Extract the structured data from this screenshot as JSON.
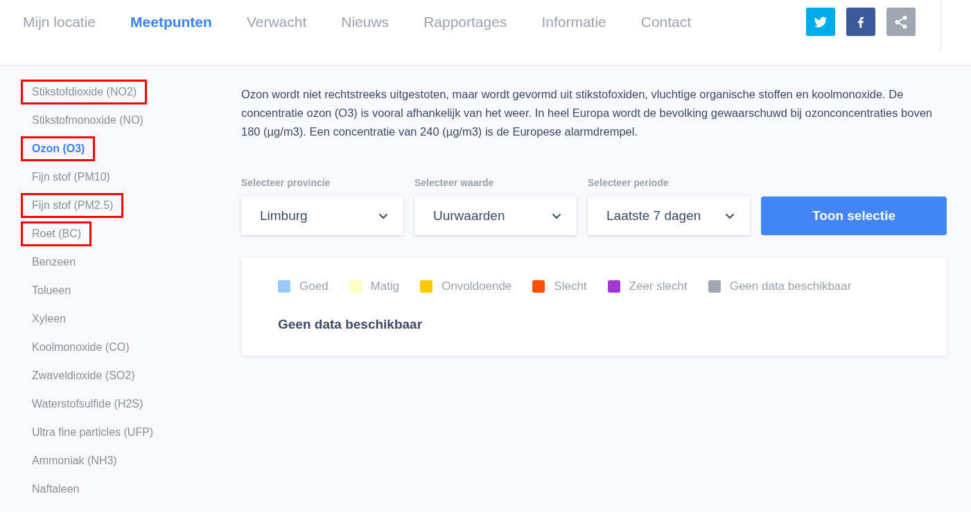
{
  "nav": [
    {
      "label": "Mijn locatie",
      "selected": false
    },
    {
      "label": "Meetpunten",
      "selected": true
    },
    {
      "label": "Verwacht",
      "selected": false
    },
    {
      "label": "Nieuws",
      "selected": false
    },
    {
      "label": "Rapportages",
      "selected": false
    },
    {
      "label": "Informatie",
      "selected": false
    },
    {
      "label": "Contact",
      "selected": false
    }
  ],
  "social": [
    {
      "kind": "twitter",
      "color": "#00aced"
    },
    {
      "kind": "facebook",
      "color": "#3b5998"
    },
    {
      "kind": "share",
      "color": "#a0a6b2"
    }
  ],
  "sidebar": {
    "items": [
      {
        "label": "Stikstofdioxide (NO2)",
        "selected": false,
        "marked": true
      },
      {
        "label": "Stikstofmonoxide (NO)",
        "selected": false,
        "marked": false
      },
      {
        "label": "Ozon (O3)",
        "selected": true,
        "marked": true
      },
      {
        "label": "Fijn stof (PM10)",
        "selected": false,
        "marked": false
      },
      {
        "label": "Fijn stof (PM2.5)",
        "selected": false,
        "marked": true
      },
      {
        "label": "Roet (BC)",
        "selected": false,
        "marked": true
      },
      {
        "label": "Benzeen",
        "selected": false,
        "marked": false
      },
      {
        "label": "Tolueen",
        "selected": false,
        "marked": false
      },
      {
        "label": "Xyleen",
        "selected": false,
        "marked": false
      },
      {
        "label": "Koolmonoxide (CO)",
        "selected": false,
        "marked": false
      },
      {
        "label": "Zwaveldioxide (SO2)",
        "selected": false,
        "marked": false
      },
      {
        "label": "Waterstofsulfide (H2S)",
        "selected": false,
        "marked": false
      },
      {
        "label": "Ultra fine particles (UFP)",
        "selected": false,
        "marked": false
      },
      {
        "label": "Ammoniak (NH3)",
        "selected": false,
        "marked": false
      },
      {
        "label": "Naftaleen",
        "selected": false,
        "marked": false
      }
    ]
  },
  "description": "Ozon wordt niet rechtstreeks uitgestoten, maar wordt gevormd uit stikstofoxiden, vluchtige organische stoffen en koolmonoxide. De concentratie ozon (O3) is vooral afhankelijk van het weer. In heel Europa wordt de bevolking gewaarschuwd bij ozonconcentraties boven 180 (µg/m3). Een concentratie van 240 (µg/m3) is de Europese alarmdrempel.",
  "filters": [
    {
      "label": "Selecteer provincie",
      "value": "Limburg"
    },
    {
      "label": "Selecteer waarde",
      "value": "Uurwaarden"
    },
    {
      "label": "Selecteer periode",
      "value": "Laatste 7 dagen"
    }
  ],
  "submit_button": "Toon selectie",
  "legend": [
    {
      "label": "Goed",
      "color": "#99c9ff"
    },
    {
      "label": "Matig",
      "color": "#ffffc4"
    },
    {
      "label": "Onvoldoende",
      "color": "#ffc800"
    },
    {
      "label": "Slecht",
      "color": "#ff5000"
    },
    {
      "label": "Zeer slecht",
      "color": "#a338d6"
    },
    {
      "label": "Geen data beschikbaar",
      "color": "#a0a6b2"
    }
  ],
  "result_message": "Geen data beschikbaar"
}
